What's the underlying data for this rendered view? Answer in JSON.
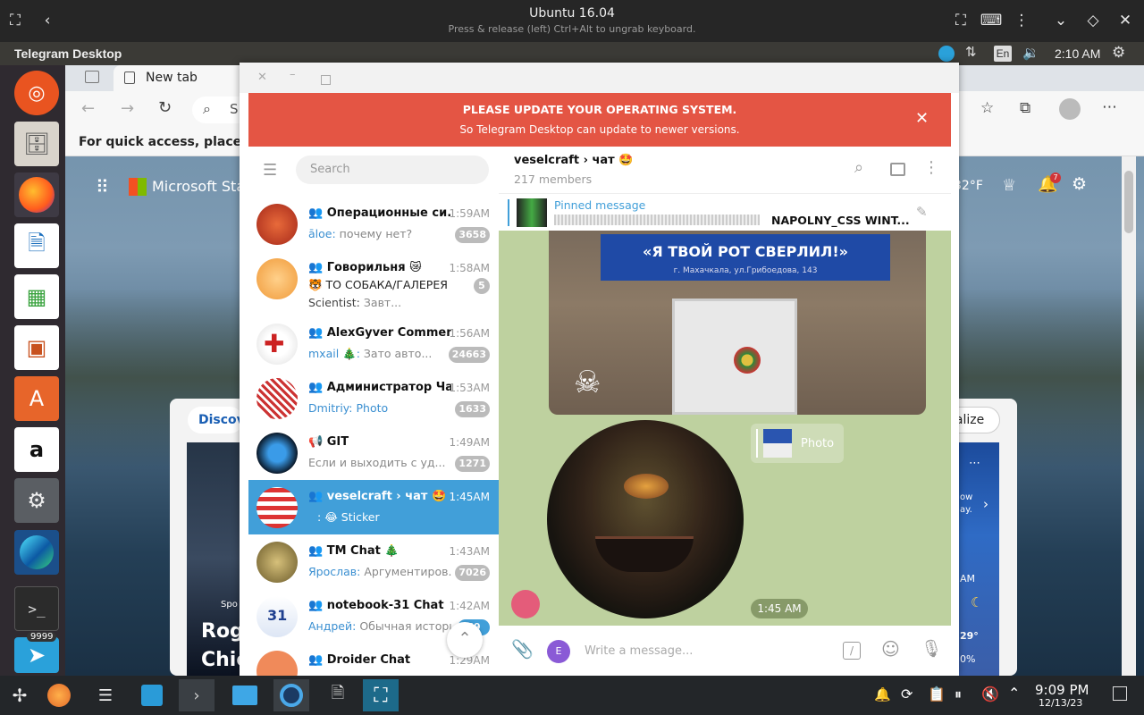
{
  "viewer": {
    "title": "Ubuntu 16.04",
    "subtitle": "Press & release (left) Ctrl+Alt to ungrab keyboard."
  },
  "panel": {
    "app_title": "Telegram Desktop",
    "lang": "En",
    "clock": "2:10 AM"
  },
  "launcher": {
    "telegram_badge": "9999"
  },
  "browser": {
    "tab_title": "New tab",
    "url_partial": "S",
    "favorites_hint": "For quick access, place you",
    "ms_brand": "Microsoft Star",
    "weather_temp": "32°F",
    "discover_label": "Discov",
    "personalize_label": "nalize",
    "headline_partial": "Rog Chie",
    "sport_label": "Spo",
    "card_right": {
      "a": "ow",
      "b": "ay.",
      "c": "AM",
      "d": "29°",
      "e": "0%"
    },
    "bell_badge": "7"
  },
  "telegram": {
    "banner_title": "PLEASE UPDATE YOUR OPERATING SYSTEM.",
    "banner_text": "So Telegram Desktop can update to newer versions.",
    "search_placeholder": "Search",
    "chats": [
      {
        "name": "Операционные си...",
        "time": "1:59AM",
        "sender": "āloe:",
        "preview": "почему нет?",
        "badge": "3658"
      },
      {
        "name": "Говорильня 😿",
        "time": "1:58AM",
        "sender": "",
        "preview": "🐯 ТО СОБАКА/ГАЛЕРЕЯ",
        "badge": "5",
        "extra": "Scientist:",
        "extra_preview": "Завт..."
      },
      {
        "name": "AlexGyver Comments",
        "time": "1:56AM",
        "sender": "mxail 🎄:",
        "preview": "Зато авто...",
        "badge": "24663"
      },
      {
        "name": "Администратор Ча...",
        "time": "1:53AM",
        "sender": "Dmitriy:",
        "preview": "Photo",
        "badge": "1633"
      },
      {
        "name": "GIT",
        "time": "1:49AM",
        "sender": "",
        "preview": "Если и выходить с уд...",
        "badge": "1271"
      },
      {
        "name": "veselcraft › чат 🤩",
        "time": "1:45AM",
        "sender": ":",
        "preview": "😂 Sticker",
        "badge": ""
      },
      {
        "name": "TM Chat 🎄",
        "time": "1:43AM",
        "sender": "Ярослав:",
        "preview": "Аргументиров...",
        "badge": "7026"
      },
      {
        "name": "notebook-31 Chat",
        "time": "1:42AM",
        "sender": "Андрей:",
        "preview": "Обычная истори...",
        "badge": "59"
      },
      {
        "name": "Droider Chat",
        "time": "1:29AM",
        "sender": "",
        "preview": "",
        "badge": ""
      }
    ],
    "chat_title": "veselcraft › чат 🤩",
    "members": "217 members",
    "pinned_label": "Pinned message",
    "pinned_text": "NAPOLNY_CSS WINT...",
    "sign_text": "«Я ТВОЙ РОТ СВЕРЛИЛ!»",
    "sign_sub": "г. Махачкала, ул.Грибоедова, 143",
    "reply_label": "Photo",
    "msg_time": "1:45 AM",
    "composer_placeholder": "Write a message...",
    "composer_avatar": "E"
  },
  "taskbar": {
    "clock_time": "9:09 PM",
    "clock_date": "12/13/23"
  }
}
